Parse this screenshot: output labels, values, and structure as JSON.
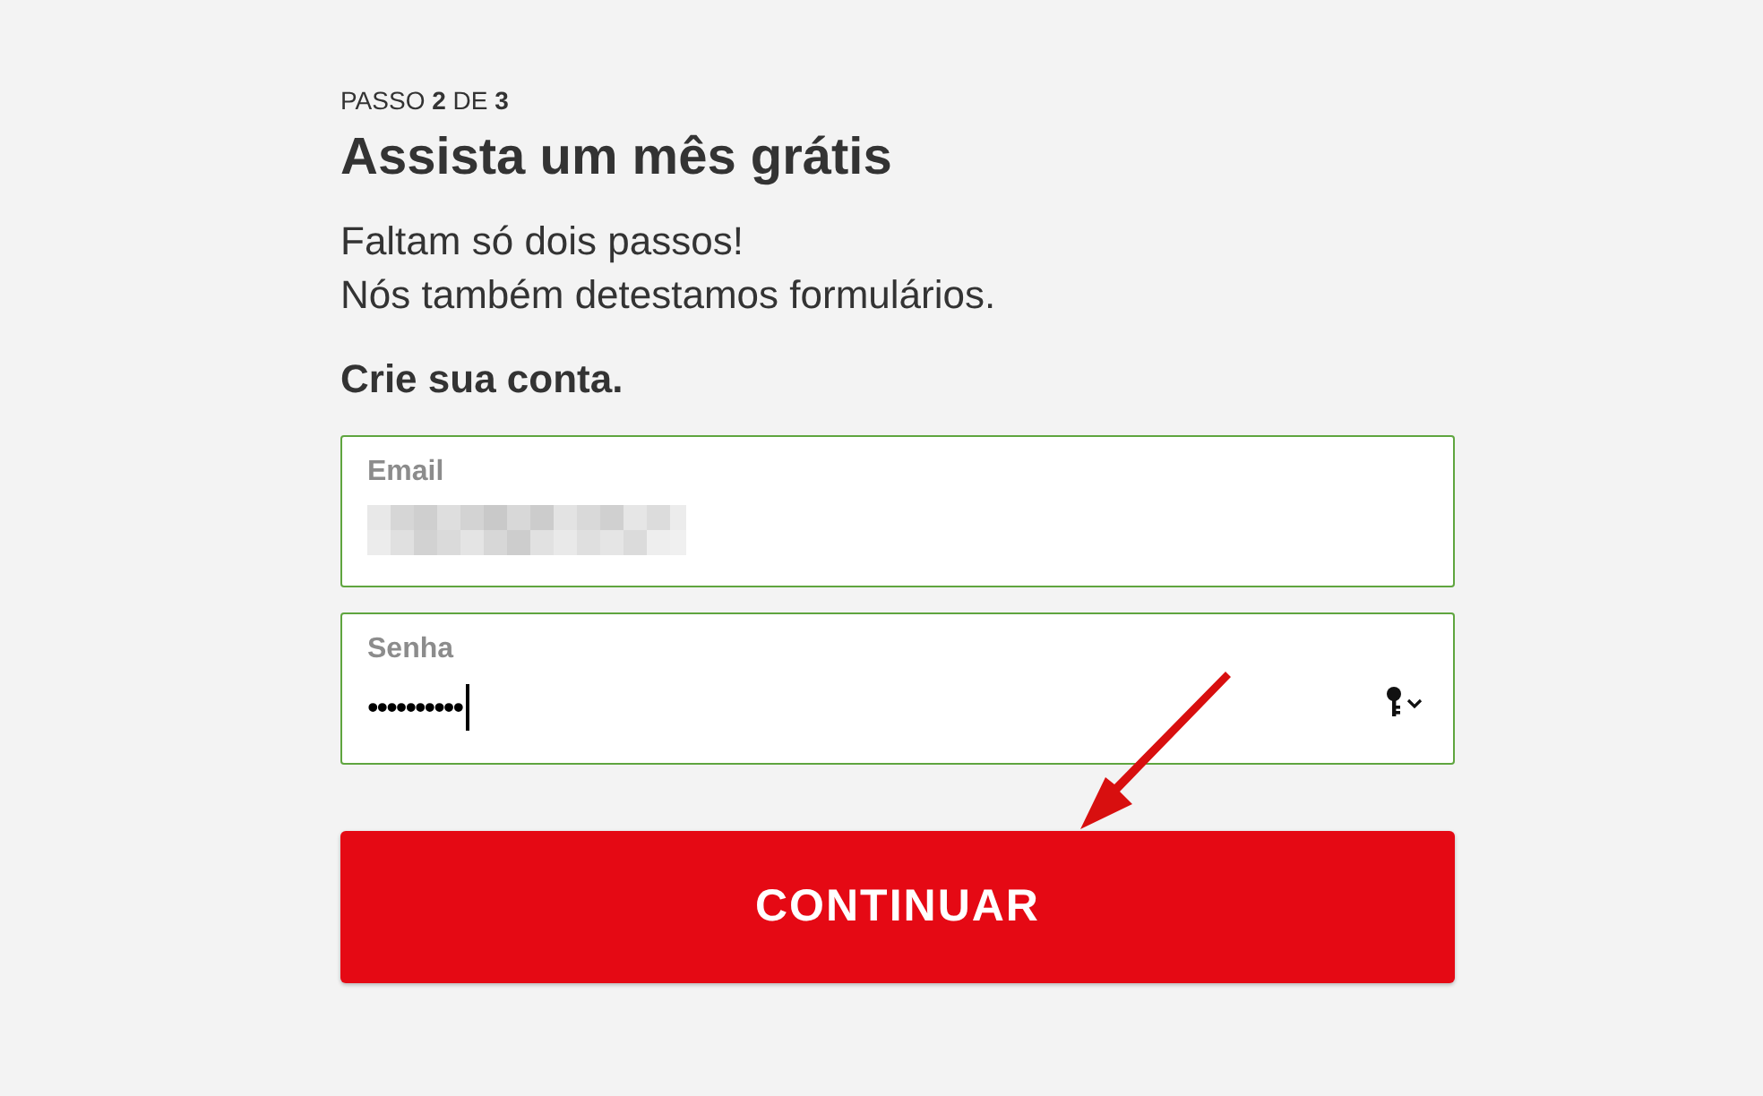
{
  "step": "PASSO **2** DE **3**",
  "title": "Assista um mês grátis",
  "intro": [
    "Faltam só dois passos!",
    "Nós também detestamos formulários."
  ],
  "subtitle": "Crie sua conta.",
  "fields": [
    {
      "kind": "email",
      "label": "Email",
      "valid": true,
      "value_redacted": true
    },
    {
      "kind": "password",
      "label": "Senha",
      "valid": true,
      "value": "••••••••••",
      "focused": true
    }
  ],
  "button": "CONTINUAR"
}
